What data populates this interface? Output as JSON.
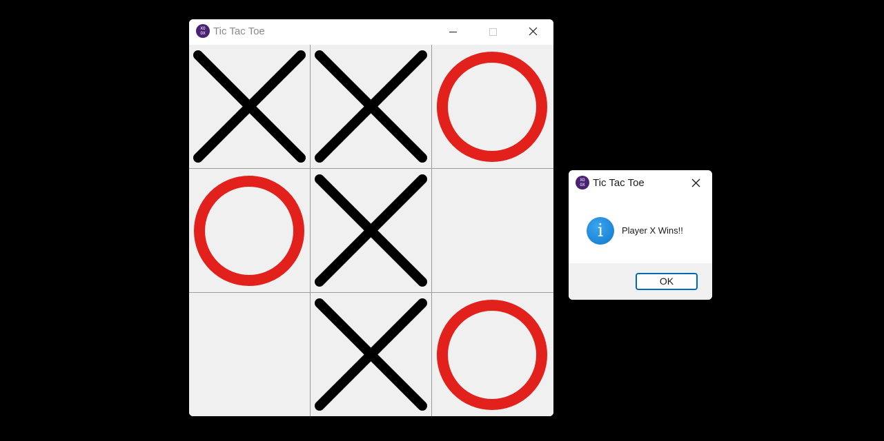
{
  "main_window": {
    "title": "Tic Tac Toe",
    "icon_name": "xoxo-icon",
    "controls": {
      "minimize": "minimize-icon",
      "maximize": "maximize-icon",
      "close": "close-icon"
    }
  },
  "board": {
    "cells": [
      [
        "X",
        "X",
        "O"
      ],
      [
        "O",
        "X",
        ""
      ],
      [
        "",
        "X",
        "O"
      ]
    ],
    "colors": {
      "x_mark": "#000000",
      "o_mark": "#e3211c",
      "cell_background": "#f0f0f0",
      "grid_line": "#9c9c9c"
    }
  },
  "dialog": {
    "title": "Tic Tac Toe",
    "icon_name": "information-icon",
    "message": "Player X Wins!!",
    "ok_label": "OK",
    "accent": "#0067c0"
  }
}
